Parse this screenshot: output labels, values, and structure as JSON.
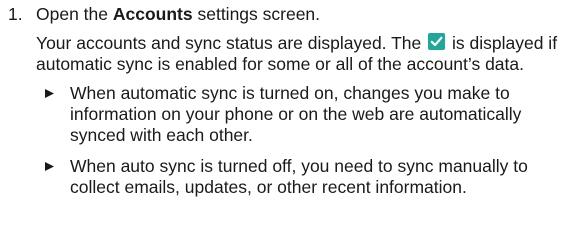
{
  "step": {
    "number": "1.",
    "text_before": "Open the ",
    "bold_word": "Accounts",
    "text_after": " settings screen."
  },
  "description": {
    "before_icon": "Your accounts and sync status are displayed. The",
    "after_icon": "is displayed if automatic sync is enabled for some or all of the account’s data.",
    "icon": "checkbox-checked-icon",
    "icon_color": "#1fa89a"
  },
  "bullets": [
    "When automatic sync is turned on, changes you make to information on your phone or on the web are automatically synced with each other.",
    "When auto sync is turned off, you need to sync manually to collect emails, updates, or other recent information."
  ]
}
